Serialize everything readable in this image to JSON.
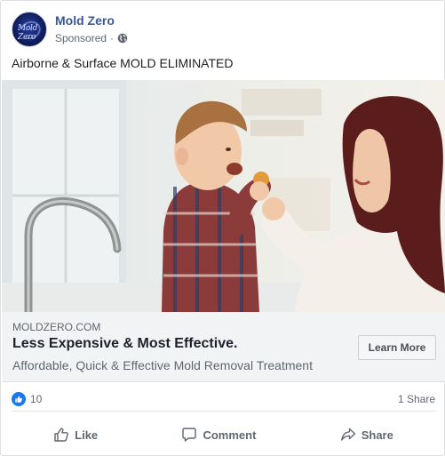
{
  "post": {
    "page_name": "Mold Zero",
    "avatar_text": "Mold Zero",
    "sponsored": "Sponsored",
    "separator": "·",
    "text": "Airborne & Surface MOLD ELIMINATED"
  },
  "link": {
    "domain": "MOLDZERO.COM",
    "headline": "Less Expensive & Most Effective.",
    "description": "Affordable, Quick & Effective Mold Removal Treatment",
    "cta_label": "Learn More"
  },
  "stats": {
    "like_count": "10",
    "shares": "1 Share"
  },
  "actions": {
    "like": "Like",
    "comment": "Comment",
    "share": "Share"
  },
  "colors": {
    "page_name": "#385898",
    "like_blue": "#1877f2",
    "muted": "#606770",
    "link_bar_bg": "#f2f3f5"
  },
  "icons": {
    "audience": "globe-icon",
    "reaction": "thumbs-up-icon",
    "like": "thumbs-up-outline-icon",
    "comment": "speech-bubble-icon",
    "share": "share-arrow-icon"
  }
}
